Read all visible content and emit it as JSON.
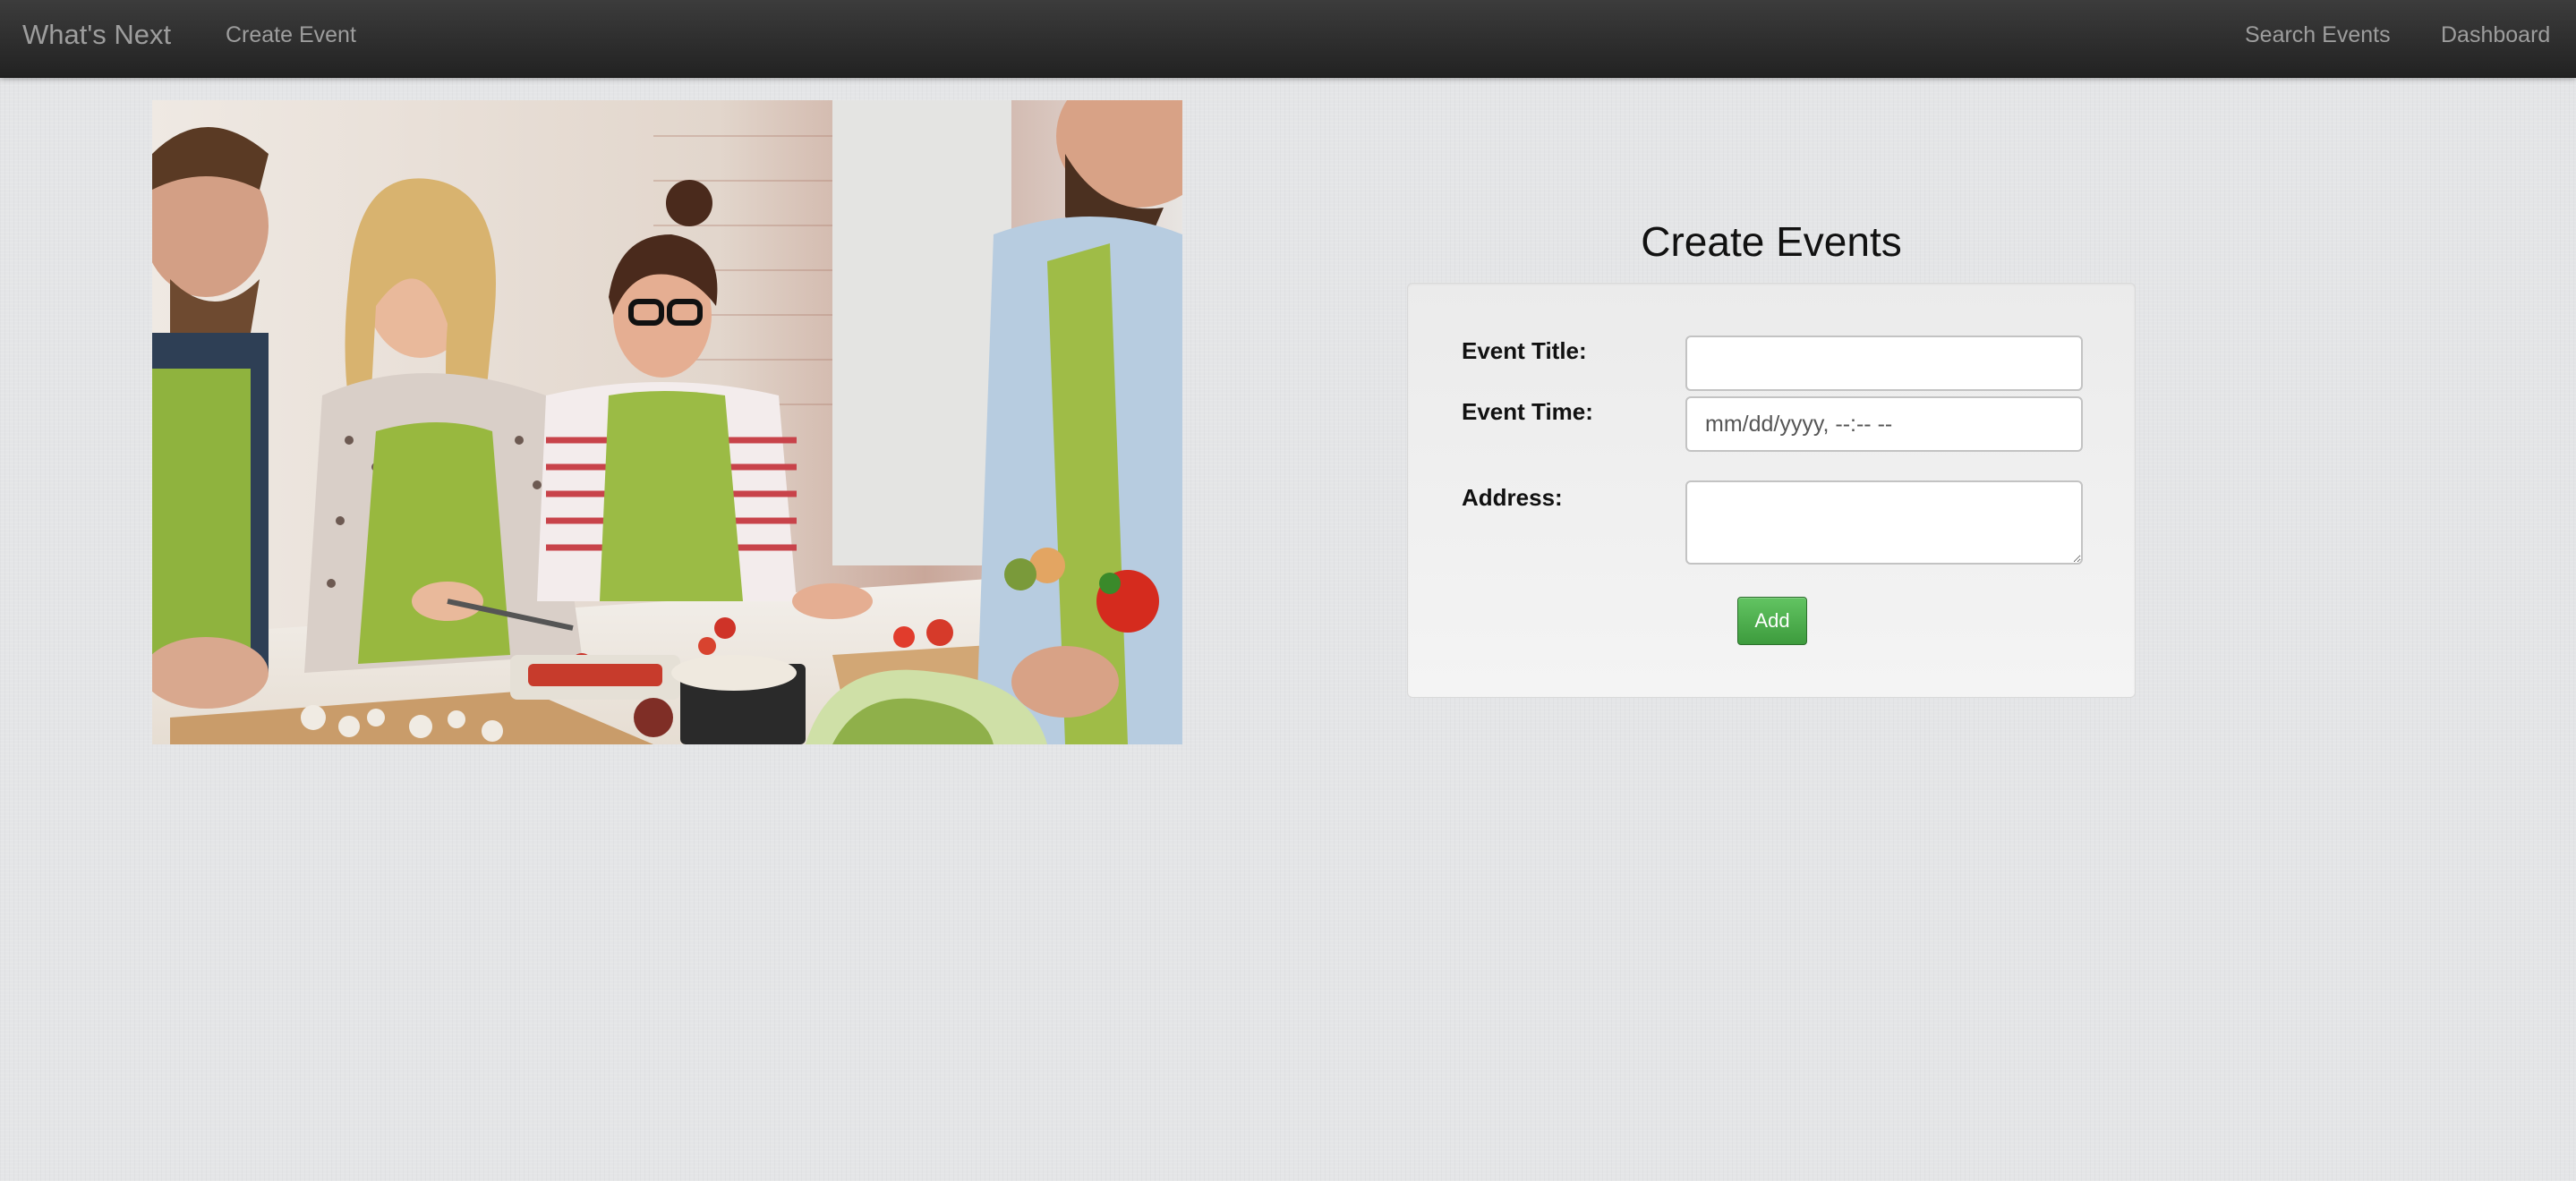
{
  "navbar": {
    "brand": "What's Next",
    "left_links": [
      "Create Event"
    ],
    "right_links": [
      "Search Events",
      "Dashboard"
    ]
  },
  "hero_image": {
    "alt": "People cooking together in a kitchen"
  },
  "form": {
    "title": "Create Events",
    "fields": [
      {
        "label": "Event Title:",
        "value": "",
        "placeholder": ""
      },
      {
        "label": "Event Time:",
        "value": "",
        "placeholder": "mm/dd/yyyy, --:-- --"
      },
      {
        "label": "Address:",
        "value": "",
        "placeholder": ""
      }
    ],
    "submit_label": "Add"
  },
  "colors": {
    "navbar_bg": "#2b2b2b",
    "nav_text": "#9d9d9d",
    "page_bg": "#e4e5e7",
    "button_green": "#4cae4c"
  }
}
